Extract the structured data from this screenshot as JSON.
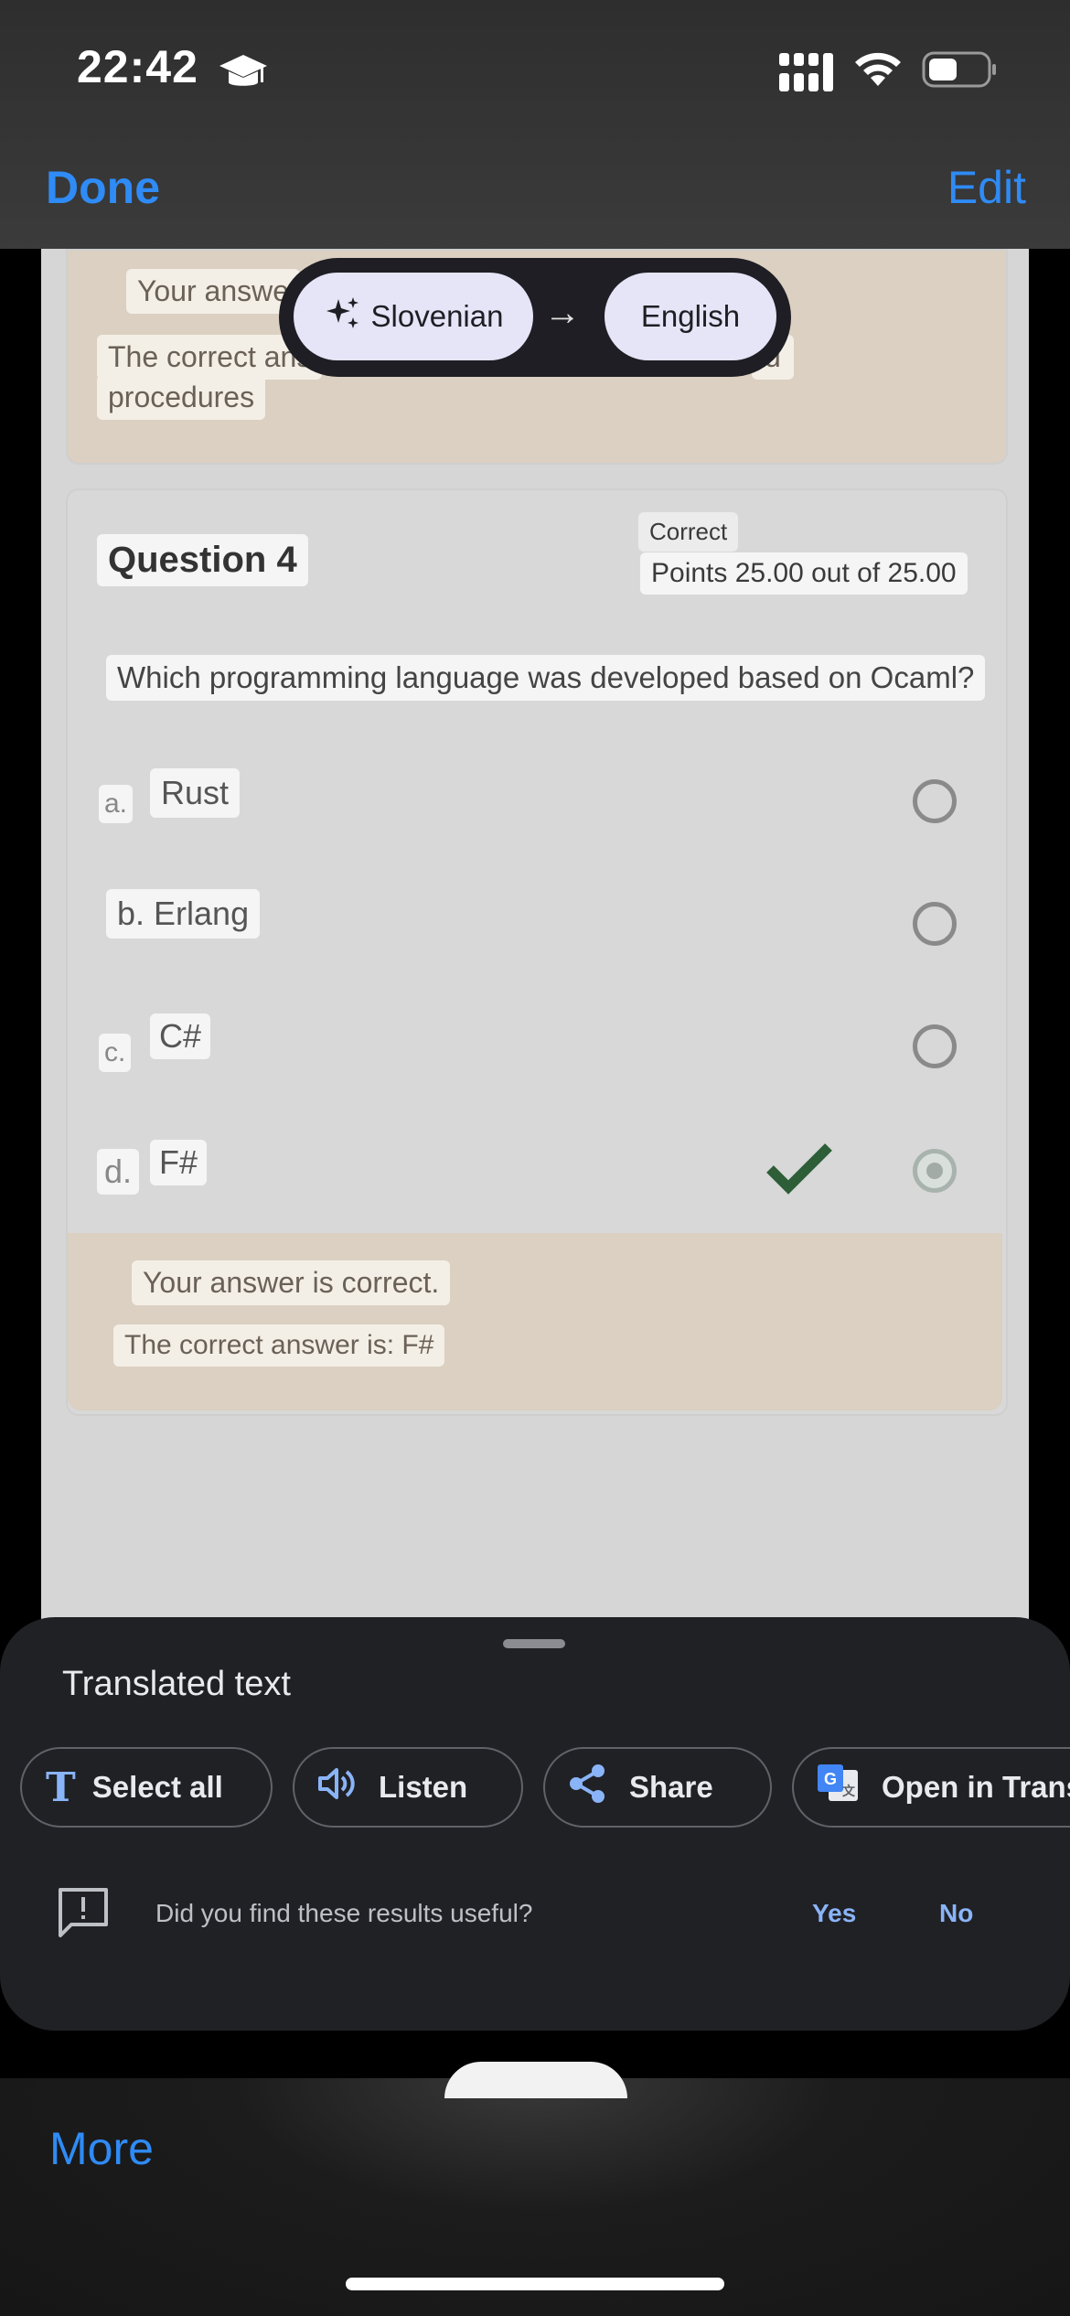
{
  "status_bar": {
    "time": "22:42"
  },
  "nav": {
    "done": "Done",
    "edit": "Edit"
  },
  "prev": {
    "your_answer_partial": "Your answe",
    "correct_partial": "The correct ans",
    "procedures": "procedures",
    "right_fragment": "d"
  },
  "language": {
    "source": "Slovenian",
    "arrow": "→",
    "target": "English"
  },
  "question": {
    "title": "Question 4",
    "status": "Correct",
    "points": "Points 25.00 out of 25.00",
    "text": "Which programming language was developed based on Ocaml?",
    "options": [
      {
        "letter": "a.",
        "text": "Rust"
      },
      {
        "text": "b. Erlang"
      },
      {
        "letter": "c.",
        "text": "C#"
      },
      {
        "letter": "d.",
        "text": "F#"
      }
    ],
    "feedback": "Your answer is correct.",
    "correct_answer": "The correct answer is: F#"
  },
  "sheet": {
    "title": "Translated text",
    "buttons": {
      "select_all": "Select all",
      "listen": "Listen",
      "share": "Share",
      "open": "Open in Trans"
    },
    "feedback_question": "Did you find these results useful?",
    "yes": "Yes",
    "no": "No"
  },
  "toolbar": {
    "more": "More"
  },
  "colors": {
    "accent": "#2f8bf5",
    "check": "#2d5e38",
    "link": "#8ab4f8"
  }
}
